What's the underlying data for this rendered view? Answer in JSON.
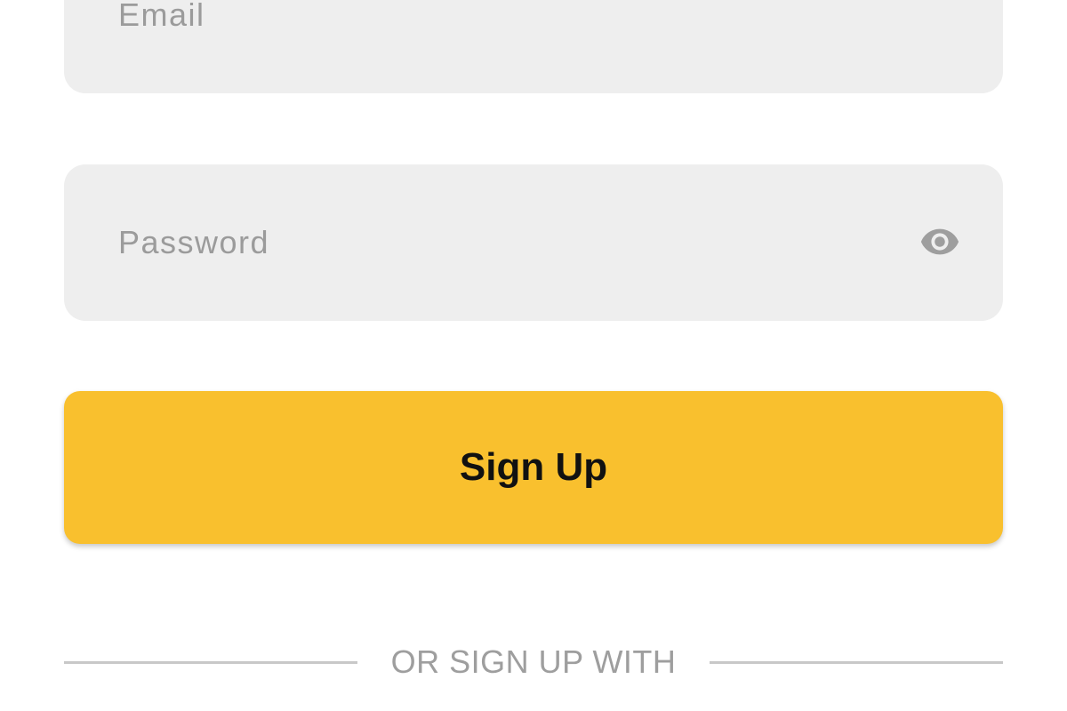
{
  "form": {
    "email": {
      "placeholder": "Email",
      "value": ""
    },
    "password": {
      "placeholder": "Password",
      "value": "",
      "visibility_icon": "eye-icon"
    },
    "signup_button_label": "Sign Up",
    "divider_text": "OR SIGN UP WITH"
  },
  "colors": {
    "field_background": "#eeeeee",
    "placeholder_text": "#9b9b9b",
    "primary_button": "#f9c02e",
    "button_text": "#111111",
    "divider": "#c8c8c8",
    "divider_text": "#9e9e9e",
    "icon": "#9e9e9e"
  }
}
